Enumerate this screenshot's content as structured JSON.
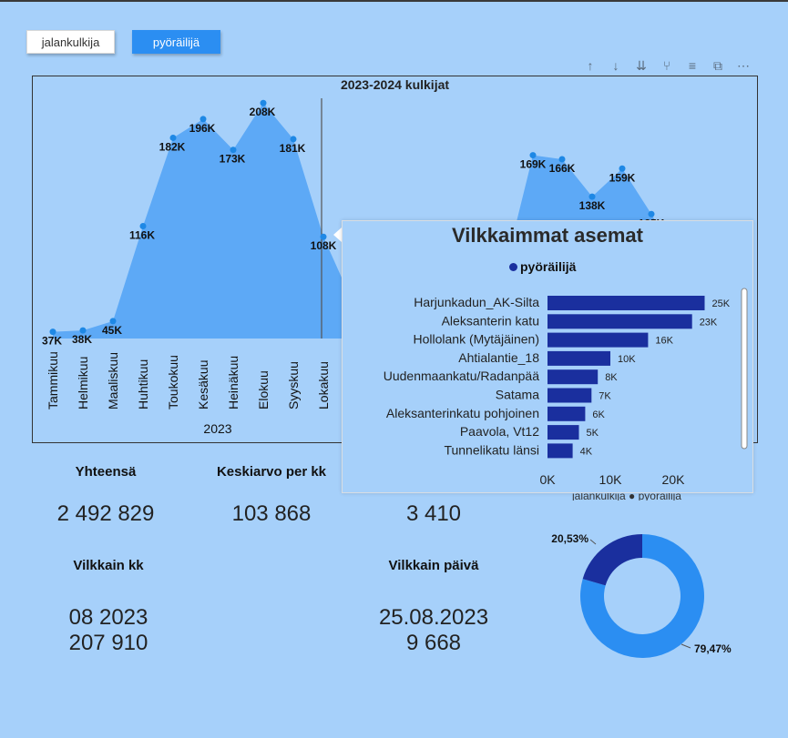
{
  "slicer": {
    "walk_label": "jalankulkija",
    "bike_label": "pyöräilijä"
  },
  "toolbar": {
    "icons": [
      "sort-ascending-icon",
      "sort-descending-icon",
      "expand-all-icon",
      "drill-up-icon",
      "filter-icon",
      "focus-mode-icon",
      "more-options-icon"
    ]
  },
  "line_chart": {
    "title": "2023-2024 kulkijat",
    "year_label": "2023",
    "colors": {
      "area": "#5da9f6",
      "point": "#1e88e5"
    }
  },
  "chart_data": {
    "type": "area",
    "title": "2023-2024 kulkijat",
    "xlabel": "2023",
    "categories": [
      "Tammikuu",
      "Helmikuu",
      "Maaliskuu",
      "Huhtikuu",
      "Toukokuu",
      "Kesäkuu",
      "Heinäkuu",
      "Elokuu",
      "Syyskuu",
      "Lokakuu"
    ],
    "values": [
      37,
      38,
      45,
      116,
      182,
      196,
      173,
      208,
      181,
      108
    ],
    "labels": [
      "37K",
      "38K",
      "45K",
      "116K",
      "182K",
      "196K",
      "173K",
      "208K",
      "181K",
      "108K"
    ],
    "values_2024_visible": [
      169,
      166,
      138,
      159,
      125
    ],
    "labels_2024_visible": [
      "169K",
      "166K",
      "138K",
      "159K",
      "125K"
    ],
    "units": "K"
  },
  "tooltip": {
    "title": "Vilkkaimmat asemat",
    "legend": "pyöräilijä",
    "bar_color": "#1a2f9e",
    "stations": [
      {
        "name": "Harjunkadun_AK-Silta",
        "value": 25,
        "label": "25K"
      },
      {
        "name": "Aleksanterin katu",
        "value": 23,
        "label": "23K"
      },
      {
        "name": "Hollolank (Mytäjäinen)",
        "value": 16,
        "label": "16K"
      },
      {
        "name": "Ahtialantie_18",
        "value": 10,
        "label": "10K"
      },
      {
        "name": "Uudenmaankatu/Radanpää",
        "value": 8,
        "label": "8K"
      },
      {
        "name": "Satama",
        "value": 7,
        "label": "7K"
      },
      {
        "name": "Aleksanterinkatu pohjoinen",
        "value": 6,
        "label": "6K"
      },
      {
        "name": "Paavola, Vt12",
        "value": 5,
        "label": "5K"
      },
      {
        "name": "Tunnelikatu länsi",
        "value": 4,
        "label": "4K"
      }
    ],
    "x_ticks": [
      "0K",
      "10K",
      "20K"
    ],
    "x_max": 28
  },
  "kpi": {
    "total_title": "Yhteensä",
    "total_value": "2 492 829",
    "avg_title": "Keskiarvo per kk",
    "avg_value": "103 868",
    "day_avg_value": "3 410",
    "busiest_month_title": "Vilkkain kk",
    "busiest_month": "08 2023",
    "busiest_month_value": "207 910",
    "busiest_day_title": "Vilkkain päivä",
    "busiest_day": "25.08.2023",
    "busiest_day_value": "9 668"
  },
  "donut": {
    "legend_text": "jalankulkija ● pyöräilijä",
    "slices": [
      {
        "name": "jalankulkija",
        "value": 79.47,
        "label": "79,47%",
        "color": "#2b8ef2"
      },
      {
        "name": "pyöräilijä",
        "value": 20.53,
        "label": "20,53%",
        "color": "#1a2f9e"
      }
    ]
  }
}
